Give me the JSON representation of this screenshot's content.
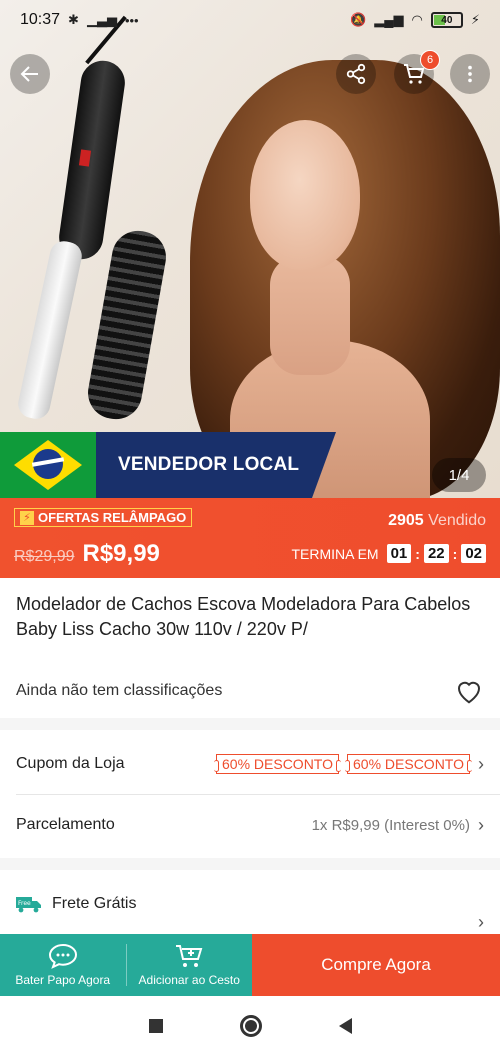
{
  "status_bar": {
    "time": "10:37",
    "battery": "40"
  },
  "carousel": {
    "banner_text": "VENDEDOR LOCAL",
    "page_indicator": "1/4"
  },
  "header": {
    "cart_count": "6"
  },
  "flash_sale": {
    "label": "OFERTAS RELÂMPAGO",
    "sold_count": "2905",
    "sold_label": "Vendido",
    "old_price": "R$29,99",
    "price": "R$9,99",
    "ends_label": "TERMINA EM",
    "hours": "01",
    "minutes": "22",
    "seconds": "02"
  },
  "product": {
    "title": "Modelador de Cachos Escova Modeladora Para Cabelos Baby Liss Cacho 30w  110v / 220v P/",
    "rating_text": "Ainda não tem classificações"
  },
  "details": {
    "coupon_label": "Cupom da Loja",
    "coupons": [
      "60% DESCONTO",
      "60% DESCONTO"
    ],
    "installment_label": "Parcelamento",
    "installment_value": "1x R$9,99 (Interest 0%)",
    "shipping_label": "Frete Grátis",
    "shipping_badge": "Free"
  },
  "actions": {
    "chat": "Bater Papo Agora",
    "add_to_cart": "Adicionar ao Cesto",
    "buy_now": "Compre Agora"
  },
  "colors": {
    "brand": "#ee4d2d",
    "teal": "#26aa99",
    "navy": "#19306b"
  }
}
